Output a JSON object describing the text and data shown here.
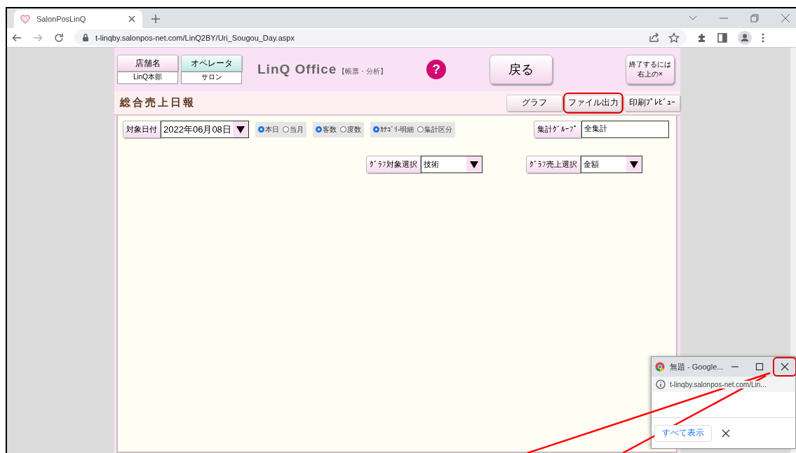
{
  "browser": {
    "tab": {
      "title": "SalonPosLinQ"
    },
    "address": {
      "url": "t-linqby.salonpos-net.com/LinQ2BY/Uri_Sougou_Day.aspx"
    }
  },
  "header": {
    "store": {
      "label": "店舗名",
      "value": "LinQ本部"
    },
    "operator": {
      "label": "オペレータ",
      "value": "サロン"
    },
    "logo": {
      "name": "LinQ Office",
      "subtitle": "【帳票・分析】"
    },
    "help": "?",
    "back_button": "戻る",
    "exit_button": [
      "終了するには",
      "右上の×"
    ]
  },
  "report": {
    "title": "総合売上日報",
    "actions": [
      {
        "label": "グラフ",
        "highlighted": false
      },
      {
        "label": "ファイル出力",
        "highlighted": true
      },
      {
        "label": "印刷ﾌﾟﾚﾋﾞｭｰ",
        "highlighted": false
      }
    ]
  },
  "filters": {
    "date": {
      "label": "対象日付",
      "value": "2022年06月08日"
    },
    "radio_groups": [
      {
        "options": [
          {
            "label": "本日",
            "selected": true
          },
          {
            "label": "当月",
            "selected": false
          }
        ]
      },
      {
        "options": [
          {
            "label": "客数",
            "selected": true
          },
          {
            "label": "度数",
            "selected": false
          }
        ]
      },
      {
        "options": [
          {
            "label": "ｶﾃｺﾞﾘ-明細",
            "selected": true
          },
          {
            "label": "集計区分",
            "selected": false
          }
        ]
      }
    ],
    "group": {
      "label": "集計ｸﾞﾙｰﾌﾟ",
      "value": "全集計"
    },
    "graph_target": {
      "label": "ｸﾞﾗﾌ対象選択",
      "value": "技術"
    },
    "graph_sales": {
      "label": "ｸﾞﾗﾌ売上選択",
      "value": "金額"
    }
  },
  "popup": {
    "title": "無題 - Google...",
    "url": "t-linqby.salonpos-net.com/Lin...",
    "show_all": "すべて表示",
    "close_highlighted": true
  }
}
